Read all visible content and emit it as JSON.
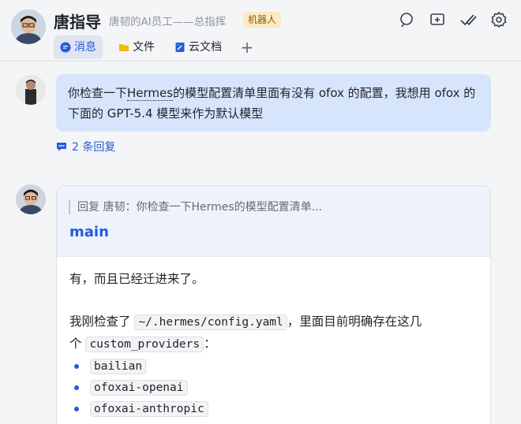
{
  "header": {
    "title": "唐指导",
    "subtitle": "唐韧的AI员工——总指挥",
    "badge": "机器人",
    "icons": [
      "search-icon",
      "add-window-icon",
      "check-double-icon",
      "settings-gear-icon"
    ]
  },
  "tabs": [
    {
      "label": "消息",
      "icon": "chat-bubble-icon",
      "active": true
    },
    {
      "label": "文件",
      "icon": "folder-icon",
      "active": false
    },
    {
      "label": "云文档",
      "icon": "cloud-doc-icon",
      "active": false
    }
  ],
  "tab_add_label": "+",
  "message1": {
    "text_before": "你检查一下",
    "text_highlight": "Hermes",
    "text_after": "的模型配置清单里面有没有 ofox 的配置，我想用 ofox 的下面的 GPT-5.4 模型来作为默认模型"
  },
  "replies_label": "2 条回复",
  "card": {
    "quote": "回复 唐韧：你检查一下Hermes的模型配置清单...",
    "title": "main",
    "line1": "有，而且已经迁进来了。",
    "line2_before": "我刚检查了 ",
    "line2_code": "~/.hermes/config.yaml",
    "line2_after": "，里面目前明确存在这几",
    "line3_before": "个 ",
    "line3_code": "custom_providers",
    "line3_after": "：",
    "providers": [
      "bailian",
      "ofoxai-openai",
      "ofoxai-anthropic"
    ]
  },
  "colors": {
    "accent": "#245bdb",
    "bubble": "#d6e4fc",
    "badge_bg": "#fbeac3"
  }
}
